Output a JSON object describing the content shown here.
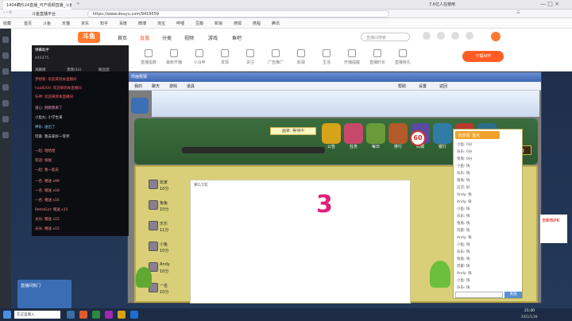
{
  "browser": {
    "tab_title": "1404瞒珍24直播_可产视频直播_斗鱼...",
    "url": "https://www.douyu.com/9419559",
    "site_label": "斗鱼直播平台",
    "search_text": "7.6亿人在使用",
    "bookmarks": [
      "收藏",
      "首页",
      "斗鱼",
      "天猫",
      "京东",
      "知乎",
      "百度",
      "微博",
      "淘宝",
      "哔哩",
      "豆瓣",
      "新浪",
      "搜狐",
      "携程",
      "腾讯"
    ]
  },
  "douyu": {
    "logo": "斗鱼",
    "nav": [
      "首页",
      "直播",
      "分类",
      "视频",
      "游戏",
      "鱼吧"
    ],
    "search_placeholder": "直播间搜索",
    "cats": [
      "直播指数",
      "最新开播",
      "小马甲",
      "发现",
      "关注",
      "广告推广",
      "影视",
      "生活",
      "开播提醒",
      "直播时长",
      "直播有礼"
    ],
    "download_btn": "下载APP",
    "win_controls": "— □ ×"
  },
  "chat": {
    "header": "弹幕助手",
    "stats": "440375",
    "tab_a": "贡献榜",
    "tab_b": "贵宾(31)",
    "tab_c": "粉丝团",
    "lines": [
      "梦想家: 欢迎来到本直播间",
      "hao8200: 欢迎来到本直播间",
      "乐神: 欢迎来到本直播间",
      "道心: 刚刚我来了",
      "小鱼丸: 小学生来",
      "神乐: 送出了",
      "玩家: 我去拿好一等奖",
      "一起: 哈哈哈",
      "欢迎: 祝福",
      "一起: 我一起去",
      "一名: 赠送 x99",
      "一名: 赠送 x18",
      "一名: 赠送 x16",
      "RetroGirl: 赠送 x15",
      "光光: 赠送 x15",
      "光光: 赠送 x15"
    ]
  },
  "game": {
    "title": "你画我猜",
    "menu": [
      "帮助",
      "设置",
      "返回"
    ],
    "tabs": [
      "我的",
      "聊天",
      "游戏",
      "道具"
    ],
    "toolbar": [
      "公告",
      "任务",
      "每日",
      "排行",
      "商城",
      "银行",
      "签到",
      "手机"
    ],
    "round_label": "第1/1轮",
    "countdown_text": "画家: 等待中",
    "timer": "60",
    "big_number": "3",
    "players": [
      {
        "name": "玩家",
        "score": "10分"
      },
      {
        "name": "兔兔",
        "score": "10分"
      },
      {
        "name": "乐乐",
        "score": "11分"
      },
      {
        "name": "小鱼",
        "score": "10分"
      },
      {
        "name": "Andy",
        "score": "10分"
      },
      {
        "name": "一名",
        "score": "10分"
      }
    ],
    "rpanel_header": "聊天",
    "rpanel_title": "当前词: 鱼丸",
    "rpanel_lines": [
      "小鱼: 0分",
      "乐乐: 0分",
      "兔兔: 0分",
      "小鱼: 快",
      "乐乐: 快",
      "兔兔: 快",
      "这次: 好",
      "Andy: 快",
      "Andy: 快",
      "小鱼: 快",
      "乐乐: 快",
      "兔兔: 快",
      "玩家: 快",
      "Andy: 快",
      "小鱼: 快",
      "乐乐: 快",
      "兔兔: 快",
      "玩家: 快",
      "Andy: 快",
      "小鱼: 快",
      "乐乐: 快"
    ],
    "send_btn": "发送",
    "ready_btn": "准备"
  },
  "taskbar": {
    "search": "在这里输入",
    "clock": "21:40",
    "date": "2021/1/28"
  },
  "ads": {
    "left_banner": "直播间热门",
    "right_ad": "全新热PK"
  },
  "colors": {
    "accent": "#ff5d23",
    "game_green": "#3b6d3e",
    "board": "#d8cf78",
    "chat_bg": "#0a0a0c"
  }
}
